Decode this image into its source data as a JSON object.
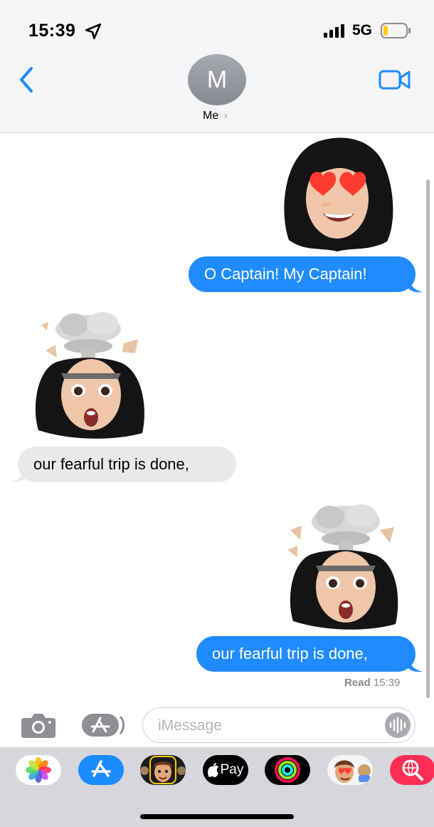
{
  "status_bar": {
    "time": "15:39",
    "network": "5G"
  },
  "header": {
    "avatar_initial": "M",
    "contact_name": "Me",
    "chevron": "›"
  },
  "messages": [
    {
      "direction": "sent",
      "text": "O Captain! My Captain!",
      "sticker": "memoji-heart-eyes"
    },
    {
      "direction": "received",
      "text": "our fearful trip is done,",
      "sticker": "memoji-mind-blown"
    },
    {
      "direction": "sent",
      "text": "our fearful trip is done,",
      "sticker": "memoji-mind-blown"
    }
  ],
  "read_receipt": {
    "label": "Read",
    "time": "15:39"
  },
  "compose": {
    "placeholder": "iMessage"
  },
  "app_drawer": [
    {
      "name": "Photos",
      "icon": "photos-icon"
    },
    {
      "name": "App Store",
      "icon": "app-store-icon"
    },
    {
      "name": "Memoji",
      "icon": "memoji-app-icon"
    },
    {
      "name": "Apple Pay",
      "icon": "apple-pay-icon",
      "label": "Pay"
    },
    {
      "name": "Activity",
      "icon": "activity-icon"
    },
    {
      "name": "Memoji Stickers",
      "icon": "memoji-stickers-icon"
    },
    {
      "name": "Web Search",
      "icon": "web-search-icon"
    }
  ],
  "colors": {
    "sent_bubble": "#1f8bff",
    "received_bubble": "#e9e9eb",
    "accent": "#1f8bff",
    "drawer": "#d6d6db"
  }
}
